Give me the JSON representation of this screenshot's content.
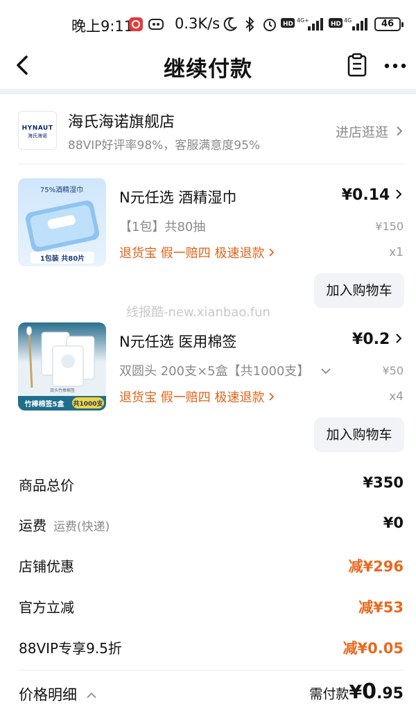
{
  "status_bar": {
    "time": "晚上9:11",
    "net_speed": "0.3K/s",
    "battery": "46",
    "icons": [
      "netease-music-icon",
      "app-icon",
      "moon-icon",
      "bluetooth-icon",
      "alarm-icon",
      "hd-icon",
      "signal-4g-icon",
      "hd-icon",
      "signal-4g-icon",
      "battery-icon"
    ]
  },
  "header": {
    "title": "继续付款"
  },
  "shop": {
    "logo_text": "HYNAUT",
    "logo_sub": "海氏海诺",
    "name": "海氏海诺旗舰店",
    "subtitle": "88VIP好评率98%，客服满意度95%",
    "enter_label": "进店逛逛"
  },
  "items": [
    {
      "thumb_caption": "75%酒精湿巾",
      "thumb_badge": "1包装 共80片",
      "name": "N元任选 酒精湿巾",
      "spec": "【1包】共80抽",
      "tags": "退货宝  假一赔四  极速退款",
      "price": "¥0.14",
      "original_price": "¥150",
      "qty": "x1",
      "cart_label": "加入购物车"
    },
    {
      "thumb_caption": "双头竹棒棉签",
      "thumb_badge": "竹棒棉签5盒",
      "thumb_badge2": "共1000支",
      "name": "N元任选 医用棉签",
      "spec": "双圆头 200支×5盒【共1000支】",
      "tags": "退货宝  假一赔四  极速退款",
      "price": "¥0.2",
      "original_price": "¥50",
      "qty": "x4",
      "cart_label": "加入购物车"
    }
  ],
  "watermark": "线报酷-new.xianbao.fun",
  "summary": [
    {
      "label": "商品总价",
      "sub": "",
      "value": "¥350",
      "accent": false
    },
    {
      "label": "运费",
      "sub": "运费(快递)",
      "value": "¥0",
      "accent": false
    },
    {
      "label": "店铺优惠",
      "sub": "",
      "value": "减¥296",
      "accent": true
    },
    {
      "label": "官方立减",
      "sub": "",
      "value": "减¥53",
      "accent": true
    },
    {
      "label": "88VIP专享9.5折",
      "sub": "",
      "value": "减¥0.05",
      "accent": true
    }
  ],
  "footer": {
    "detail_label": "价格明细",
    "need_pay_label": "需付款",
    "currency": "¥",
    "amount_int": "0",
    "amount_dec": ".95"
  },
  "colors": {
    "accent": "#e8691f",
    "muted": "#8a8a8a",
    "band": "#eef1f6",
    "cart_bg": "#f1f3f6"
  }
}
